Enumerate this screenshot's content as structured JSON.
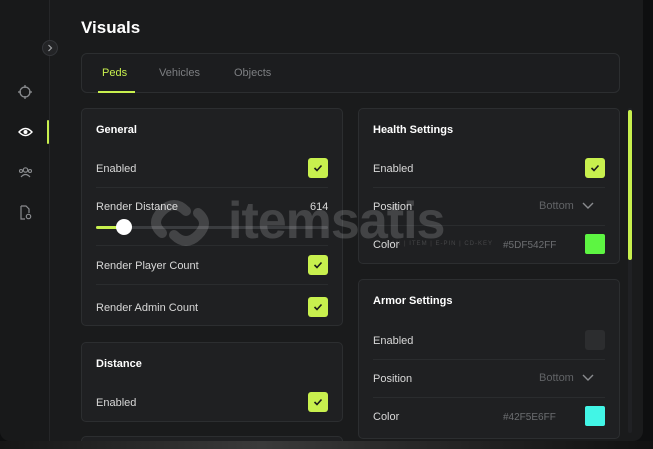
{
  "page": {
    "title": "Visuals"
  },
  "rail": {
    "collapse_icon": "chevron-right-icon",
    "items": [
      {
        "icon": "crosshair-icon",
        "active": false
      },
      {
        "icon": "eye-icon",
        "active": true
      },
      {
        "icon": "users-icon",
        "active": false
      },
      {
        "icon": "file-settings-icon",
        "active": false
      }
    ]
  },
  "tabs": [
    {
      "label": "Peds",
      "active": true
    },
    {
      "label": "Vehicles",
      "active": false
    },
    {
      "label": "Objects",
      "active": false
    }
  ],
  "general": {
    "title": "General",
    "enabled_label": "Enabled",
    "enabled": true,
    "render_distance_label": "Render Distance",
    "render_distance_value": "614",
    "render_distance_fraction": 0.12,
    "render_player_count_label": "Render Player Count",
    "render_player_count": true,
    "render_admin_count_label": "Render Admin Count",
    "render_admin_count": true
  },
  "distance": {
    "title": "Distance",
    "enabled_label": "Enabled",
    "enabled": true
  },
  "health": {
    "title": "Health Settings",
    "enabled_label": "Enabled",
    "enabled": true,
    "position_label": "Position",
    "position_value": "Bottom",
    "color_label": "Color",
    "color_hex": "#5DF542FF",
    "color_swatch": "#5df542"
  },
  "armor": {
    "title": "Armor Settings",
    "enabled_label": "Enabled",
    "enabled": false,
    "position_label": "Position",
    "position_value": "Bottom",
    "color_label": "Color",
    "color_hex": "#42F5E6FF",
    "color_swatch": "#42f5e6"
  },
  "watermark": {
    "text": "itemsatis",
    "subtext": "SAN | ITEM | E-PIN | CD-KEY"
  },
  "colors": {
    "accent": "#c8f04e",
    "background": "#1a1b1c",
    "card": "#1f2022"
  }
}
